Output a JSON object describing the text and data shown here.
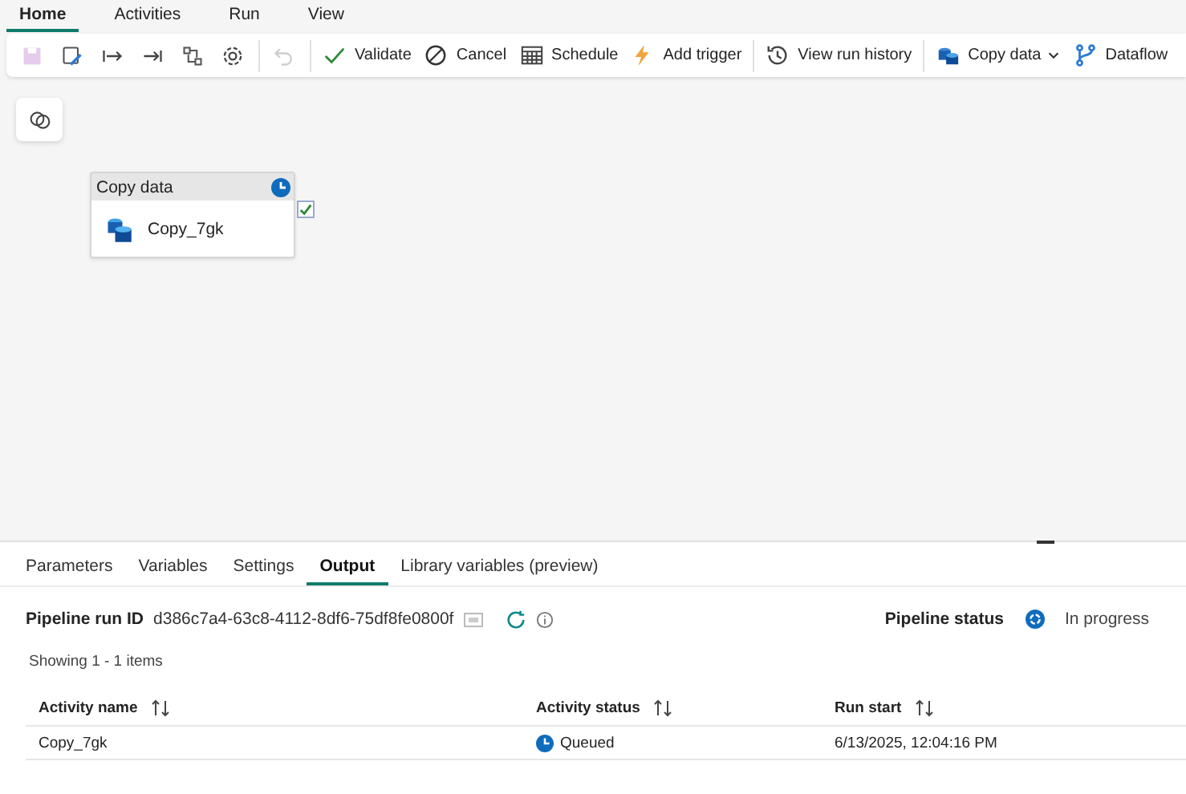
{
  "menu_tabs": [
    {
      "label": "Home",
      "selected": true
    },
    {
      "label": "Activities",
      "selected": false
    },
    {
      "label": "Run",
      "selected": false
    },
    {
      "label": "View",
      "selected": false
    }
  ],
  "toolbar": {
    "icon_buttons": [
      {
        "disabled": true
      },
      {
        "disabled": false
      },
      {
        "disabled": false
      },
      {
        "disabled": false
      },
      {
        "disabled": false
      },
      {
        "disabled": false
      }
    ],
    "undo": {
      "disabled": true
    },
    "actions": [
      {
        "label": "Validate",
        "dropdown": false
      },
      {
        "label": "Cancel",
        "dropdown": false
      },
      {
        "label": "Schedule",
        "dropdown": false
      },
      {
        "label": "Add trigger",
        "dropdown": false
      },
      {
        "label": "View run history",
        "dropdown": false
      },
      {
        "label": "Copy data",
        "dropdown": true
      },
      {
        "label": "Dataflow",
        "dropdown": false
      }
    ]
  },
  "canvas": {
    "node": {
      "title": "Copy data",
      "activity": "Copy_7gk",
      "queued": true,
      "checked": true
    }
  },
  "output_panel": {
    "tabs": [
      {
        "label": "Parameters",
        "selected": false
      },
      {
        "label": "Variables",
        "selected": false
      },
      {
        "label": "Settings",
        "selected": false
      },
      {
        "label": "Output",
        "selected": true
      },
      {
        "label": "Library variables (preview)",
        "selected": false
      }
    ],
    "run_id_label": "Pipeline run ID",
    "run_id": "d386c7a4-63c8-4112-8df6-75df8fe0800f",
    "status_label": "Pipeline status",
    "status": "In progress",
    "showing": "Showing 1 - 1 items",
    "table": {
      "columns": [
        "Activity name",
        "Activity status",
        "Run start"
      ],
      "rows": [
        {
          "activity_name": "Copy_7gk",
          "activity_status": "Queued",
          "run_start": "6/13/2025, 12:04:16 PM"
        }
      ]
    }
  }
}
